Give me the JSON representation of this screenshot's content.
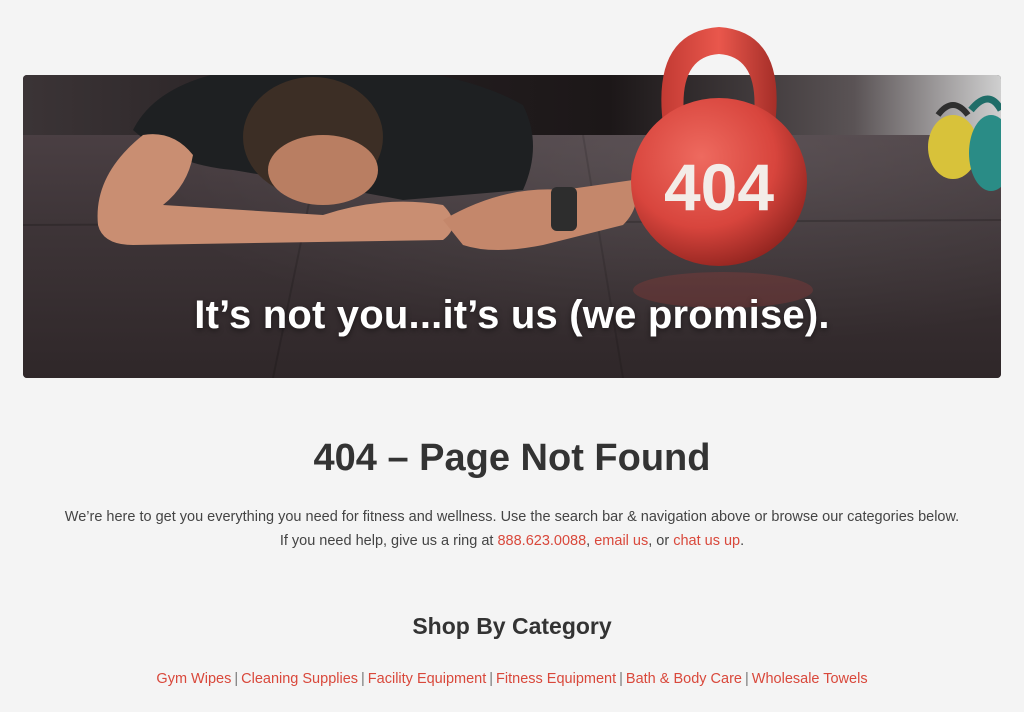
{
  "hero": {
    "caption": "It’s not you...it’s us (we promise).",
    "kettlebell_label": "404"
  },
  "main": {
    "title": "404 – Page Not Found",
    "intro_line1": "We’re here to get you everything you need for fitness and wellness. Use the search bar & navigation above or browse our categories below.",
    "intro_line2_prefix": "If you need help, give us a ring at ",
    "phone": "888.623.0088",
    "comma1": ", ",
    "email_link": "email us",
    "comma2": ", or ",
    "chat_link": "chat us up",
    "period": "."
  },
  "categories": {
    "title": "Shop By Category",
    "separator": "|",
    "items": [
      {
        "label": "Gym Wipes"
      },
      {
        "label": "Cleaning Supplies"
      },
      {
        "label": "Facility Equipment"
      },
      {
        "label": "Fitness Equipment"
      },
      {
        "label": "Bath & Body Care"
      },
      {
        "label": "Wholesale Towels"
      }
    ]
  },
  "colors": {
    "accent": "#d9483b",
    "background": "#f4f4f4",
    "text": "#333333",
    "kettlebell": "#d8453d"
  }
}
